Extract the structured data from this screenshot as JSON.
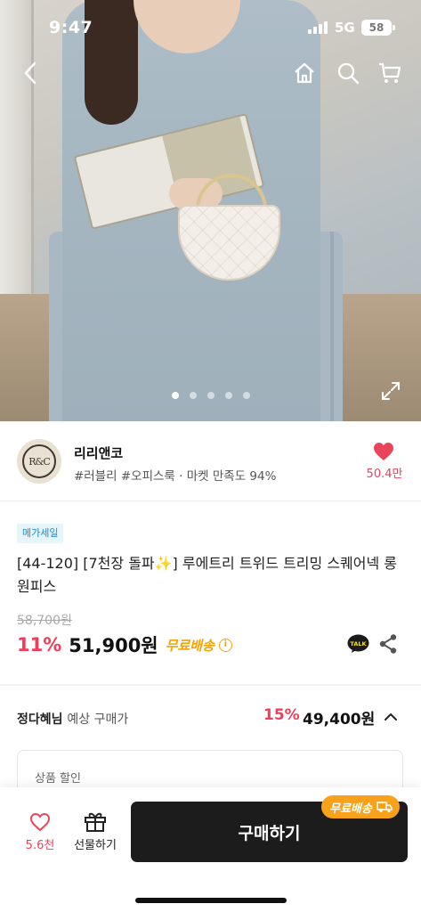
{
  "status_bar": {
    "time": "9:47",
    "network": "5G",
    "battery": "58"
  },
  "hero": {
    "slide_count": 5,
    "active_slide": 1
  },
  "seller": {
    "name": "리리앤코",
    "tags": "#러블리 #오피스룩 · 마켓 만족도 94%",
    "likes": "50.4만"
  },
  "product": {
    "badge": "메가세일",
    "title": "[44-120] [7천장 돌파✨] 루에트리 트위드 트리밍 스퀘어넥 롱 원피스",
    "original_price": "58,700원",
    "discount": "11%",
    "price": "51,900원",
    "free_shipping": "무료배송",
    "info_icon_label": "i"
  },
  "member": {
    "name": "정다혜님",
    "label": "예상 구매가",
    "discount": "15%",
    "price": "49,400원"
  },
  "discount_box": {
    "label": "상품 할인"
  },
  "bottom_bar": {
    "wish_count": "5.6천",
    "gift_label": "선물하기",
    "buy_label": "구매하기",
    "ship_pill": "무료배송"
  },
  "colors": {
    "accent_red": "#ef3e5a",
    "heart_red": "#e8455a",
    "free_ship_orange": "#f5a300",
    "buy_button": "#1c1c1c"
  }
}
